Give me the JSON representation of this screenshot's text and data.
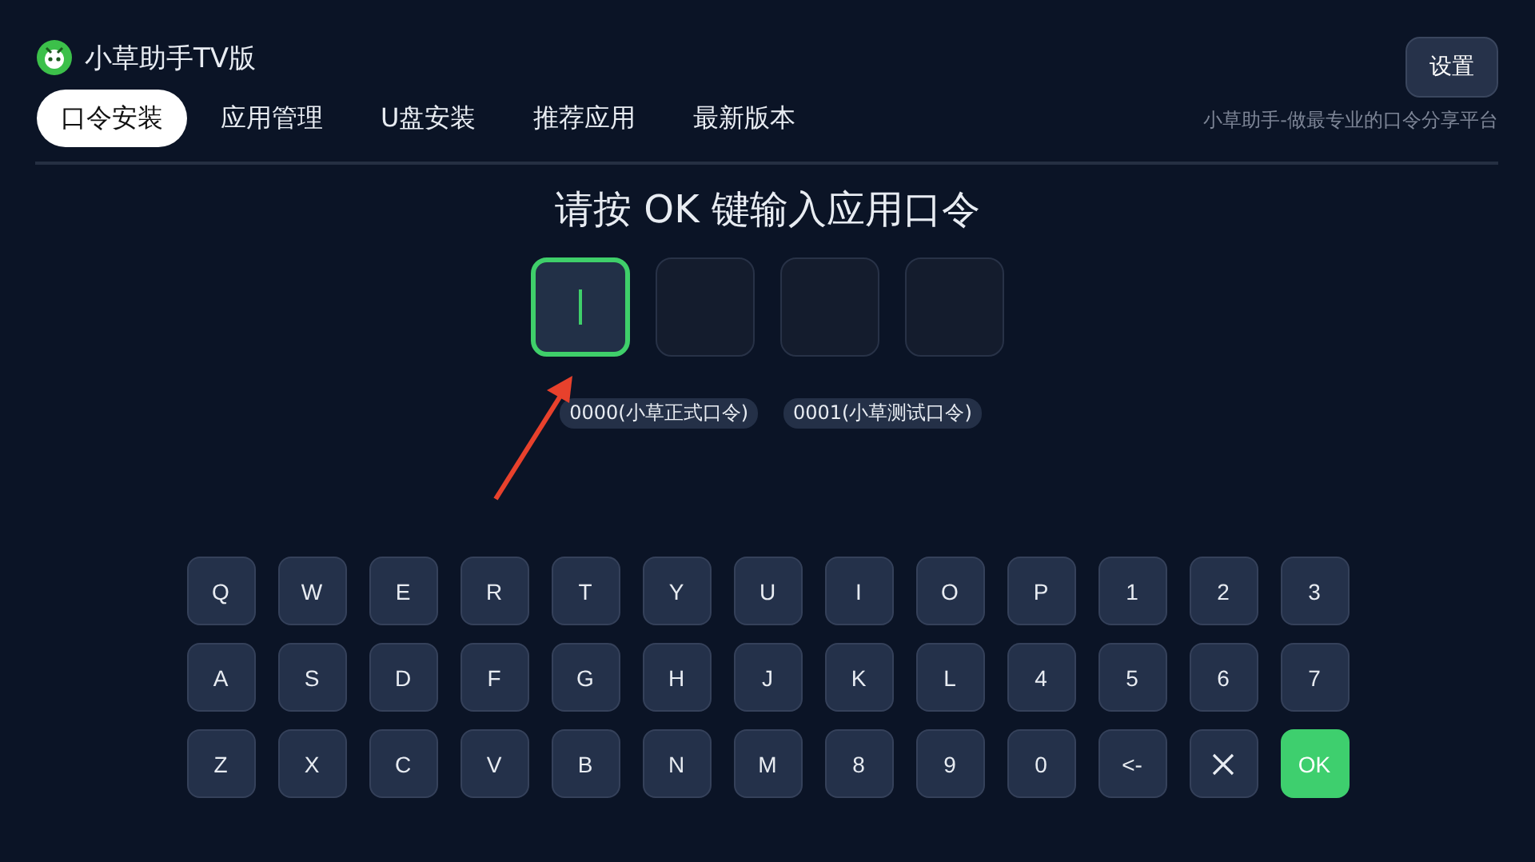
{
  "app": {
    "title": "小草助手TV版"
  },
  "tabs": [
    {
      "label": "口令安装",
      "selected": true
    },
    {
      "label": "应用管理",
      "selected": false
    },
    {
      "label": "U盘安装",
      "selected": false
    },
    {
      "label": "推荐应用",
      "selected": false
    },
    {
      "label": "最新版本",
      "selected": false
    }
  ],
  "settings_button": "设置",
  "slogan": "小草助手-做最专业的口令分享平台",
  "prompt": "请按 OK 键输入应用口令",
  "code_boxes": [
    {
      "selected": true
    },
    {
      "selected": false
    },
    {
      "selected": false
    },
    {
      "selected": false
    }
  ],
  "hints": [
    "0000(小草正式口令)",
    "0001(小草测试口令)"
  ],
  "keyboard": [
    [
      {
        "kind": "char",
        "label": "Q"
      },
      {
        "kind": "char",
        "label": "W"
      },
      {
        "kind": "char",
        "label": "E"
      },
      {
        "kind": "char",
        "label": "R"
      },
      {
        "kind": "char",
        "label": "T"
      },
      {
        "kind": "char",
        "label": "Y"
      },
      {
        "kind": "char",
        "label": "U"
      },
      {
        "kind": "char",
        "label": "I"
      },
      {
        "kind": "char",
        "label": "O"
      },
      {
        "kind": "char",
        "label": "P"
      },
      {
        "kind": "char",
        "label": "1"
      },
      {
        "kind": "char",
        "label": "2"
      },
      {
        "kind": "char",
        "label": "3"
      }
    ],
    [
      {
        "kind": "char",
        "label": "A"
      },
      {
        "kind": "char",
        "label": "S"
      },
      {
        "kind": "char",
        "label": "D"
      },
      {
        "kind": "char",
        "label": "F"
      },
      {
        "kind": "char",
        "label": "G"
      },
      {
        "kind": "char",
        "label": "H"
      },
      {
        "kind": "char",
        "label": "J"
      },
      {
        "kind": "char",
        "label": "K"
      },
      {
        "kind": "char",
        "label": "L"
      },
      {
        "kind": "char",
        "label": "4"
      },
      {
        "kind": "char",
        "label": "5"
      },
      {
        "kind": "char",
        "label": "6"
      },
      {
        "kind": "char",
        "label": "7"
      }
    ],
    [
      {
        "kind": "char",
        "label": "Z"
      },
      {
        "kind": "char",
        "label": "X"
      },
      {
        "kind": "char",
        "label": "C"
      },
      {
        "kind": "char",
        "label": "V"
      },
      {
        "kind": "char",
        "label": "B"
      },
      {
        "kind": "char",
        "label": "N"
      },
      {
        "kind": "char",
        "label": "M"
      },
      {
        "kind": "char",
        "label": "8"
      },
      {
        "kind": "char",
        "label": "9"
      },
      {
        "kind": "char",
        "label": "0"
      },
      {
        "kind": "char",
        "label": "<-"
      },
      {
        "kind": "clear"
      },
      {
        "kind": "ok",
        "label": "OK"
      }
    ]
  ]
}
